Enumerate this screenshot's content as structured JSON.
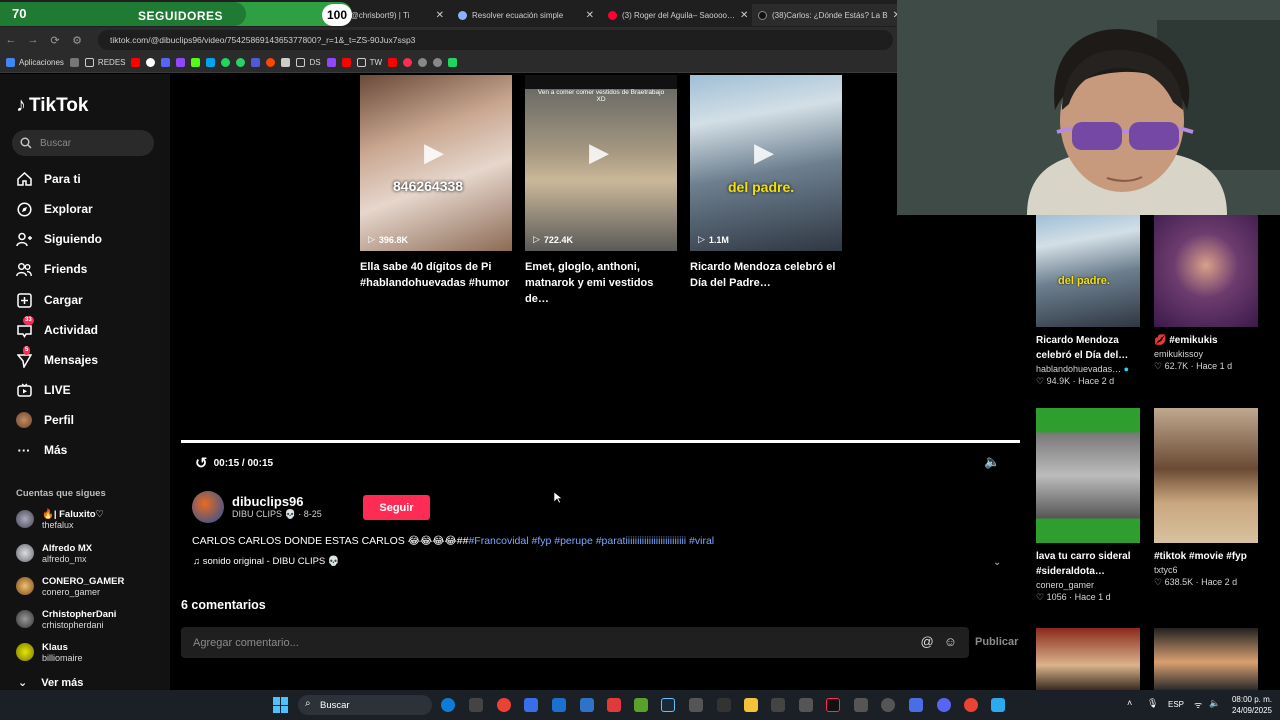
{
  "overlay": {
    "followers_count": "70",
    "followers_label": "SEGUIDORES",
    "followers_goal": "100",
    "followers_progress": 0.7
  },
  "browser": {
    "tabs": [
      {
        "title": "…sport (@chrisbort9) | Ti"
      },
      {
        "title": "Resolver ecuación simple"
      },
      {
        "title": "(3) Roger del Aguila– Saoooo…"
      },
      {
        "title": "(38)Carlos: ¿Dónde Estás? La B"
      }
    ],
    "url": "tiktok.com/@dibuclips96/video/7542586914365377800?_r=1&_t=ZS-90Jux7ssp3",
    "bookmarks": [
      "Aplicaciones",
      "REDES",
      "DS",
      "TW"
    ]
  },
  "sidebar": {
    "logo": "TikTok",
    "search_placeholder": "Buscar",
    "items": [
      {
        "label": "Para ti",
        "icon": "home-icon"
      },
      {
        "label": "Explorar",
        "icon": "compass-icon"
      },
      {
        "label": "Siguiendo",
        "icon": "user-follow-icon"
      },
      {
        "label": "Friends",
        "icon": "friends-icon"
      },
      {
        "label": "Cargar",
        "icon": "upload-icon"
      },
      {
        "label": "Actividad",
        "icon": "inbox-icon",
        "badge": "33"
      },
      {
        "label": "Mensajes",
        "icon": "send-icon",
        "badge": "5"
      },
      {
        "label": "LIVE",
        "icon": "live-icon"
      },
      {
        "label": "Perfil",
        "icon": "profile-avatar-icon"
      },
      {
        "label": "Más",
        "icon": "more-dots-icon"
      }
    ],
    "following_title": "Cuentas que sigues",
    "following": [
      {
        "name": "🔥| Faluxito♡",
        "handle": "thefalux"
      },
      {
        "name": "Alfredo MX",
        "handle": "alfredo_mx"
      },
      {
        "name": "CONERO_GAMER",
        "handle": "conero_gamer"
      },
      {
        "name": "CrhistopherDani",
        "handle": "crhistopherdani"
      },
      {
        "name": "Klaus",
        "handle": "billiomaire"
      }
    ],
    "see_more": "Ver más"
  },
  "related_videos": [
    {
      "title": "Ella sabe 40 dígitos de Pi #hablandohuevadas #humor",
      "views": "396.8K",
      "overlay": "846264338"
    },
    {
      "title": "Emet, gloglo, anthoni, matnarok y emi vestidos de…",
      "views": "722.4K",
      "overlay": "Ven a comer comer vestidos de Braetrabajo XD"
    },
    {
      "title": "Ricardo Mendoza celebró el Día del Padre…",
      "views": "1.1M",
      "overlay": "del padre."
    }
  ],
  "player": {
    "time": "00:15 / 00:15",
    "progress": 1.0
  },
  "video": {
    "author": "dibuclips96",
    "author_sub": "DIBU CLIPS 💀 · 8-25",
    "follow_label": "Seguir",
    "caption_text": "CARLOS CARLOS DONDE ESTAS CARLOS 😂😂😂😂##",
    "hashtags": "#Francovidal #fyp #perupe #paratiiiiiiiiiiiiiiiiiiiiiiiiii #viral",
    "sound": "♫ sonido original - DIBU CLIPS 💀"
  },
  "comments": {
    "count_label": "6 comentarios",
    "placeholder": "Agregar comentario...",
    "publish_label": "Publicar"
  },
  "recommendations": [
    {
      "title": "Ricardo Mendoza celebró el Día del…",
      "author": "hablandohuevadas…",
      "likes": "94.9K",
      "age": "Hace 2 d"
    },
    {
      "title": "💋 #emikukis",
      "author": "emikukissoy",
      "likes": "62.7K",
      "age": "Hace 1 d"
    },
    {
      "title": "lava tu carro sideral #sideraldota…",
      "author": "conero_gamer",
      "likes": "1056",
      "age": "Hace 1 d"
    },
    {
      "title": "#tiktok #movie #fyp",
      "author": "txtyc6",
      "likes": "638.5K",
      "age": "Hace 2 d"
    }
  ],
  "taskbar": {
    "search_label": "Buscar",
    "lang": "ESP",
    "time": "08:00 p. m.",
    "date": "24/09/2025"
  }
}
